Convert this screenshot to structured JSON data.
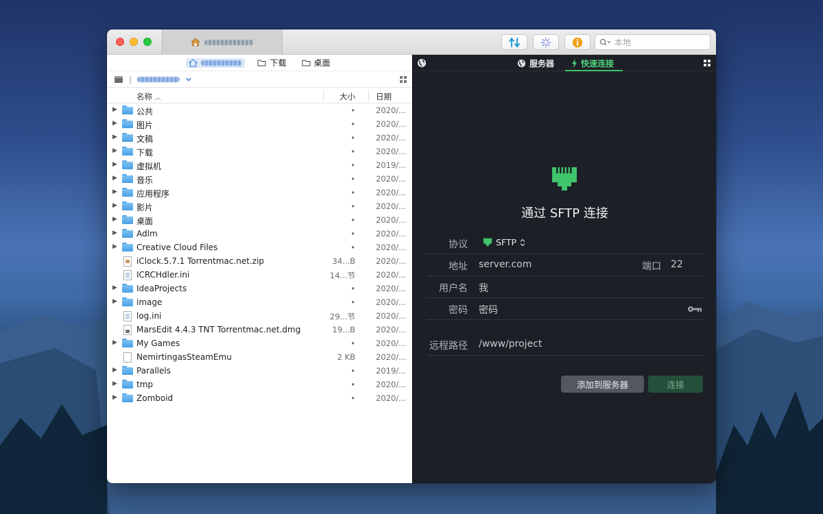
{
  "window": {
    "tab_title": "",
    "search_placeholder": "本地"
  },
  "left_pane": {
    "bookmarks": [
      {
        "label": ""
      },
      {
        "label": "下载"
      },
      {
        "label": "桌面"
      }
    ],
    "columns": {
      "name": "名称",
      "size": "大小",
      "date": "日期"
    },
    "files": [
      {
        "name": "公共",
        "size": "•",
        "date": "2020/...",
        "kind": "folder"
      },
      {
        "name": "图片",
        "size": "•",
        "date": "2020/...",
        "kind": "folder"
      },
      {
        "name": "文稿",
        "size": "•",
        "date": "2020/...",
        "kind": "folder"
      },
      {
        "name": "下载",
        "size": "•",
        "date": "2020/...",
        "kind": "folder"
      },
      {
        "name": "虚拟机",
        "size": "•",
        "date": "2019/...",
        "kind": "folder"
      },
      {
        "name": "音乐",
        "size": "•",
        "date": "2020/...",
        "kind": "folder"
      },
      {
        "name": "应用程序",
        "size": "•",
        "date": "2020/...",
        "kind": "folder"
      },
      {
        "name": "影片",
        "size": "•",
        "date": "2020/...",
        "kind": "folder"
      },
      {
        "name": "桌面",
        "size": "•",
        "date": "2020/...",
        "kind": "folder"
      },
      {
        "name": "Adlm",
        "size": "•",
        "date": "2020/...",
        "kind": "folder"
      },
      {
        "name": "Creative Cloud Files",
        "size": "•",
        "date": "2020/...",
        "kind": "folder"
      },
      {
        "name": "iClock.5.7.1 Torrentmac.net.zip",
        "size": "34...B",
        "date": "2020/...",
        "kind": "zip"
      },
      {
        "name": "ICRCHdler.ini",
        "size": "14...节",
        "date": "2020/...",
        "kind": "ini"
      },
      {
        "name": "IdeaProjects",
        "size": "•",
        "date": "2020/...",
        "kind": "folder"
      },
      {
        "name": "image",
        "size": "•",
        "date": "2020/...",
        "kind": "folder"
      },
      {
        "name": "log.ini",
        "size": "29...节",
        "date": "2020/...",
        "kind": "ini"
      },
      {
        "name": "MarsEdit 4.4.3  TNT Torrentmac.net.dmg",
        "size": "19...B",
        "date": "2020/...",
        "kind": "dmg"
      },
      {
        "name": "My Games",
        "size": "•",
        "date": "2020/...",
        "kind": "folder"
      },
      {
        "name": "NemirtingasSteamEmu",
        "size": "2 KB",
        "date": "2020/...",
        "kind": "file"
      },
      {
        "name": "Parallels",
        "size": "•",
        "date": "2019/...",
        "kind": "folder"
      },
      {
        "name": "tmp",
        "size": "•",
        "date": "2020/...",
        "kind": "folder"
      },
      {
        "name": "Zomboid",
        "size": "•",
        "date": "2020/...",
        "kind": "folder"
      }
    ]
  },
  "right_pane": {
    "tabs": {
      "servers": "服务器",
      "quick_connect": "快速连接"
    },
    "heading": "通过 SFTP 连接",
    "form": {
      "protocol_label": "协议",
      "protocol_value": "SFTP",
      "address_label": "地址",
      "address_placeholder": "server.com",
      "port_label": "端口",
      "port_value": "22",
      "user_label": "用户名",
      "user_placeholder": "我",
      "password_label": "密码",
      "password_placeholder": "密码",
      "remote_path_label": "远程路径",
      "remote_path_placeholder": "/www/project"
    },
    "buttons": {
      "add_to_servers": "添加到服务器",
      "connect": "连接"
    }
  },
  "colors": {
    "accent_green": "#3fc46b",
    "panel_dark": "#1d1f26",
    "folder_blue": "#5aa7e8"
  }
}
